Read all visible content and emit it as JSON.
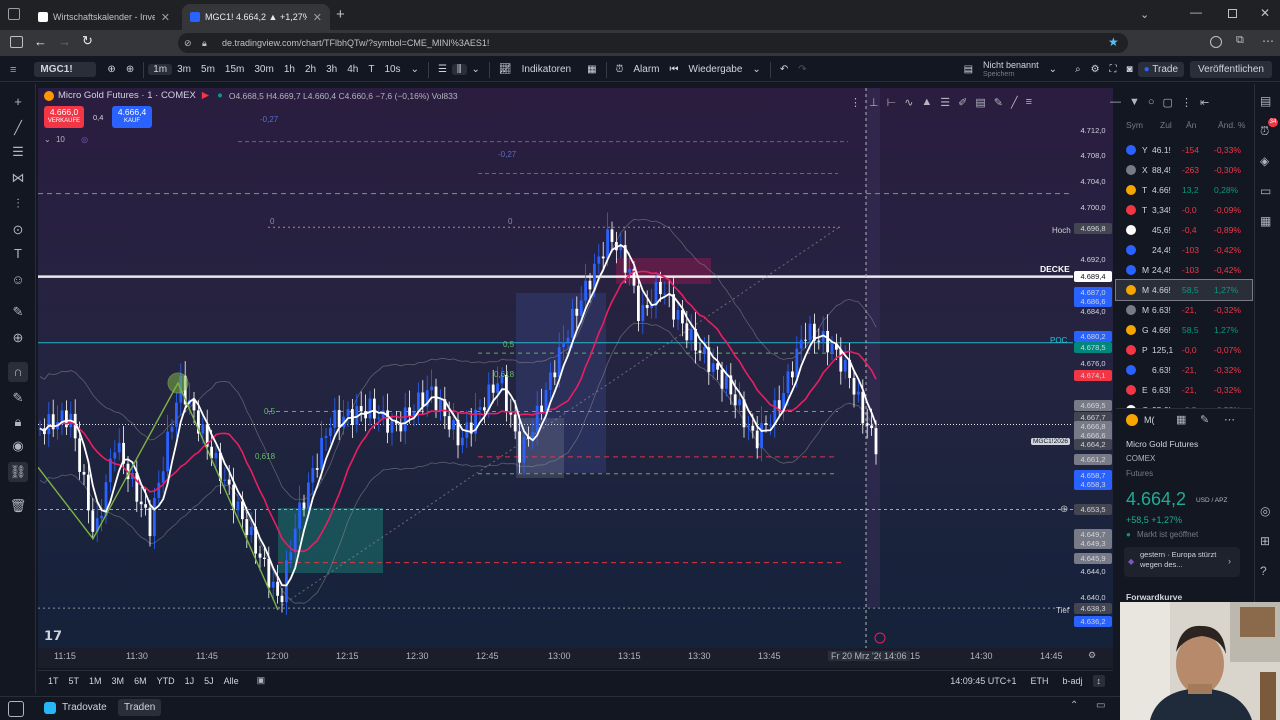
{
  "browser": {
    "tabs": [
      {
        "label": "Wirtschaftskalender - Investing",
        "active": false
      },
      {
        "label": "MGC1! 4.664,2 ▲ +1,27% Nicht",
        "active": true
      }
    ],
    "url": "de.tradingview.com/chart/TFlbhQTw/?symbol=CME_MINI%3AES1!"
  },
  "toolbar": {
    "symbol": "MGC1!",
    "intervals": [
      "1m",
      "3m",
      "5m",
      "15m",
      "30m",
      "1h",
      "2h",
      "3h",
      "4h",
      "T",
      "10s"
    ],
    "indicators_label": "Indikatoren",
    "alarm_label": "Alarm",
    "replay_label": "Wiedergabe",
    "layout_name": "Nicht benannt",
    "layout_sub": "Speichern",
    "trade_label": "Trade",
    "publish_label": "Veröffentlichen"
  },
  "legend": {
    "title": "Micro Gold Futures · 1 · COMEX",
    "ohlc": "O4.668,5 H4.669,7 L4.660,4 C4.660,6 −7,6 (−0,16%) Vol833",
    "sell_price": "4.666,0",
    "sell_label": "VERKAUFE",
    "spread": "0,4",
    "buy_price": "4.666,4",
    "buy_label": "KAUF",
    "indicator_value": "10"
  },
  "chart_labels": {
    "hoch": "Hoch",
    "decke": "DECKE",
    "poc": "POC",
    "tief": "Tief",
    "fib_05": "0,5",
    "fib_0618": "0,618",
    "fib_0": "0",
    "fib_027": "-0,27",
    "symbol_tag": "MGC1!2026"
  },
  "price_axis": [
    {
      "label": "4.712,0",
      "kind": "tick"
    },
    {
      "label": "4.708,0",
      "kind": "tick"
    },
    {
      "label": "4.704,0",
      "kind": "tick"
    },
    {
      "label": "4.700,0",
      "kind": "tick"
    },
    {
      "label": "4.696,8",
      "kind": "tag-dark"
    },
    {
      "label": "4.692,0",
      "kind": "tick"
    },
    {
      "label": "4.689,4",
      "kind": "tag-white"
    },
    {
      "label": "4.687,0",
      "kind": "tag-blue"
    },
    {
      "label": "4.686,6",
      "kind": "tag-blue"
    },
    {
      "label": "4.684,0",
      "kind": "tick"
    },
    {
      "label": "4.680,2",
      "kind": "tag-blue"
    },
    {
      "label": "4.678,5",
      "kind": "tag-teal"
    },
    {
      "label": "4.676,0",
      "kind": "tick"
    },
    {
      "label": "4.674,1",
      "kind": "tag-red"
    },
    {
      "label": "4.669,5",
      "kind": "tag-grey"
    },
    {
      "label": "4.667,7",
      "kind": "tag-dark"
    },
    {
      "label": "4.666,8",
      "kind": "tag-grey"
    },
    {
      "label": "4.666,6",
      "kind": "tag-grey"
    },
    {
      "label": "4.664,2",
      "kind": "tag-dark"
    },
    {
      "label": "4.661,2",
      "kind": "tag-grey"
    },
    {
      "label": "4.658,7",
      "kind": "tag-blue"
    },
    {
      "label": "4.658,3",
      "kind": "tag-blue"
    },
    {
      "label": "4.653,5",
      "kind": "tag-dark"
    },
    {
      "label": "4.649,7",
      "kind": "tag-grey"
    },
    {
      "label": "4.649,3",
      "kind": "tag-grey"
    },
    {
      "label": "4.645,9",
      "kind": "tag-grey"
    },
    {
      "label": "4.644,0",
      "kind": "tick"
    },
    {
      "label": "4.640,0",
      "kind": "tick"
    },
    {
      "label": "4.638,3",
      "kind": "tag-dark"
    },
    {
      "label": "4.636,2",
      "kind": "tag-blue"
    }
  ],
  "time_axis": [
    "11:15",
    "11:30",
    "11:45",
    "12:00",
    "12:15",
    "12:30",
    "12:45",
    "13:00",
    "13:15",
    "13:30",
    "13:45",
    "Fr 20 Mrz '26",
    "14:06",
    "15",
    "14:30",
    "14:45"
  ],
  "bottom_bar": {
    "ranges": [
      "1T",
      "5T",
      "1M",
      "3M",
      "6M",
      "YTD",
      "1J",
      "5J",
      "Alle"
    ],
    "clock": "14:09:45 UTC+1",
    "session": "ETH",
    "adj": "b-adj"
  },
  "footer": {
    "broker": "Tradovate",
    "trade_label": "Traden"
  },
  "watchlist": {
    "headers": [
      "Sym",
      "Zul",
      "Än",
      "Änd. %"
    ],
    "rows": [
      {
        "sym": "Y",
        "last": "46.1!",
        "chg": "-154",
        "pct": "-0,33%",
        "color": "#f23645",
        "icon_color": "#2962ff"
      },
      {
        "sym": "X",
        "last": "88,4!",
        "chg": "-263",
        "pct": "-0,30%",
        "color": "#f23645",
        "icon_color": "#787b86"
      },
      {
        "sym": "T",
        "last": "4.66!",
        "chg": "13,2",
        "pct": "0,28%",
        "color": "#089981",
        "icon_color": "#f7a600"
      },
      {
        "sym": "T",
        "last": "3,34!",
        "chg": "-0,0",
        "pct": "-0,09%",
        "color": "#f23645",
        "icon_color": "#f23645"
      },
      {
        "sym": "",
        "last": "45,6!",
        "chg": "-0,4",
        "pct": "-0,89%",
        "color": "#f23645",
        "icon_color": "#ffffff"
      },
      {
        "sym": "",
        "last": "24,4!",
        "chg": "-103",
        "pct": "-0,42%",
        "color": "#f23645",
        "icon_color": "#2962ff"
      },
      {
        "sym": "M",
        "last": "24,4!",
        "chg": "-103",
        "pct": "-0,42%",
        "color": "#f23645",
        "icon_color": "#2962ff"
      },
      {
        "sym": "M",
        "last": "4.66!",
        "chg": "58,5",
        "pct": "1,27%",
        "color": "#089981",
        "icon_color": "#f7a600",
        "selected": true
      },
      {
        "sym": "M",
        "last": "6.63!",
        "chg": "-21,",
        "pct": "-0,32%",
        "color": "#f23645",
        "icon_color": "#787b86"
      },
      {
        "sym": "G",
        "last": "4.66!",
        "chg": "58,5",
        "pct": "1,27%",
        "color": "#089981",
        "icon_color": "#f7a600"
      },
      {
        "sym": "P",
        "last": "125,1",
        "chg": "-0,0",
        "pct": "-0,07%",
        "color": "#f23645",
        "icon_color": "#f23645"
      },
      {
        "sym": "",
        "last": "6.63!",
        "chg": "-21,",
        "pct": "-0,32%",
        "color": "#f23645",
        "icon_color": "#2962ff"
      },
      {
        "sym": "E",
        "last": "6.63!",
        "chg": "-21,",
        "pct": "-0,32%",
        "color": "#f23645",
        "icon_color": "#f23645"
      },
      {
        "sym": "C",
        "last": "95,0!",
        "chg": "-0,5",
        "pct": "-0,52%",
        "color": "#f23645",
        "icon_color": "#ffffff"
      }
    ]
  },
  "details": {
    "short": "M(",
    "name": "Micro Gold Futures",
    "exchange": "COMEX",
    "type": "Futures",
    "price": "4.664,2",
    "currency": "USD / APZ",
    "change": "+58,5 +1,27%",
    "market_status": "Markt ist geöffnet",
    "news": "gestern · Europa stürzt wegen des...",
    "forward_label": "Forwardkurve"
  },
  "colors": {
    "bg": "#131722",
    "up": "#2962ff",
    "down": "#ffffff",
    "accent_green": "#089981",
    "accent_red": "#f23645",
    "ema_red": "#e91e63"
  }
}
